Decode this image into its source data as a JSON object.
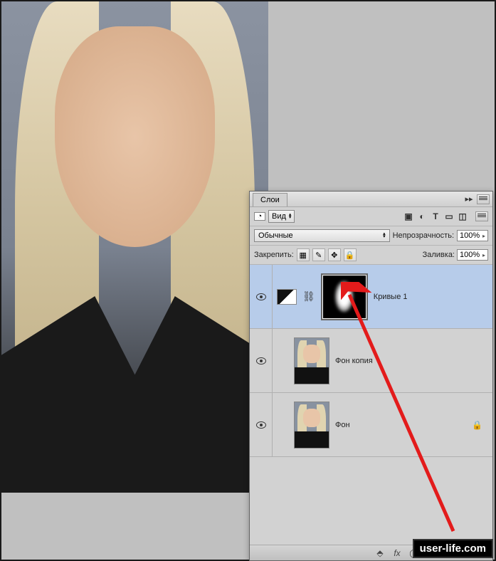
{
  "panel": {
    "tab_label": "Слои",
    "kind_dropdown": "Вид",
    "blend_mode": "Обычные",
    "opacity_label": "Непрозрачность:",
    "opacity_value": "100%",
    "lock_label": "Закрепить:",
    "fill_label": "Заливка:",
    "fill_value": "100%",
    "filter_icons": [
      "image-icon",
      "adjust-icon",
      "type-icon",
      "shape-icon",
      "smart-icon"
    ]
  },
  "layers": [
    {
      "name": "Кривые 1",
      "type": "adjustment",
      "selected": true,
      "visible": true,
      "locked": false,
      "has_mask": true
    },
    {
      "name": "Фон копия",
      "type": "image",
      "selected": false,
      "visible": true,
      "locked": false
    },
    {
      "name": "Фон",
      "type": "image",
      "selected": false,
      "visible": true,
      "locked": true
    }
  ],
  "footer_icons": [
    "link-icon",
    "fx-icon",
    "mask-icon",
    "fill-adjust-icon",
    "group-icon",
    "new-layer-icon",
    "trash-icon"
  ],
  "watermark": "user-life.com"
}
